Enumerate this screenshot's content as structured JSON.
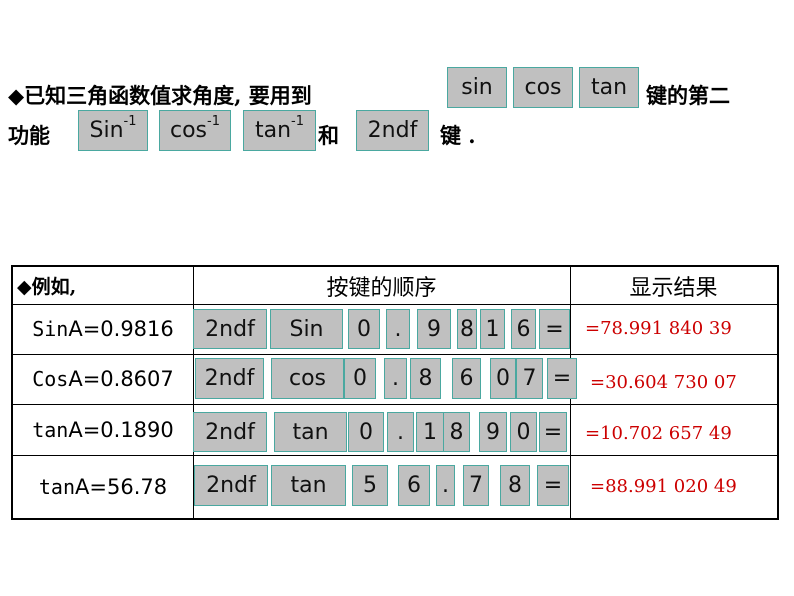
{
  "intro": {
    "line1_text": "◆已知三角函数值求角度, 要用到",
    "line1_keys": [
      "sin",
      "cos",
      "tan"
    ],
    "line1_suffix": "键的第二",
    "line2_prefix": "功能",
    "line2_keys": [
      {
        "base": "Sin",
        "sup": "-1"
      },
      {
        "base": "cos",
        "sup": "-1"
      },
      {
        "base": "tan",
        "sup": "-1"
      }
    ],
    "line2_and": "和",
    "line2_key_2ndf": "2ndf",
    "line2_suffix": "键 ."
  },
  "table": {
    "headers": {
      "example": "◆例如,",
      "sequence": "按键的顺序",
      "result": "显示结果"
    },
    "rows": [
      {
        "fn": "Sin",
        "rest": "A=0.9816",
        "keys": [
          "2ndf",
          "Sin",
          "0",
          ".",
          "9",
          "8",
          "1",
          "6",
          "="
        ],
        "result": "=78.991 840 39"
      },
      {
        "fn": "Cos",
        "rest": "A=0.8607",
        "keys": [
          "2ndf",
          "cos",
          "0",
          ".",
          "8",
          "6",
          "0",
          "7",
          "="
        ],
        "result": "=30.604 730 07"
      },
      {
        "fn": "tan",
        "rest": "A=0.1890",
        "keys": [
          "2ndf",
          "tan",
          "0",
          ".",
          "1",
          "8",
          "9",
          "0",
          "="
        ],
        "result": "=10.702 657 49"
      },
      {
        "fn": "tan",
        "rest": "A=56.78",
        "keys": [
          "2ndf",
          "tan",
          "5",
          "6",
          ".",
          "7",
          "8",
          "="
        ],
        "result": "=88.991 020 49"
      }
    ]
  },
  "colors": {
    "key_bg": "#c0c0c0",
    "key_border": "#4aa8a0",
    "result": "#cc0000"
  }
}
